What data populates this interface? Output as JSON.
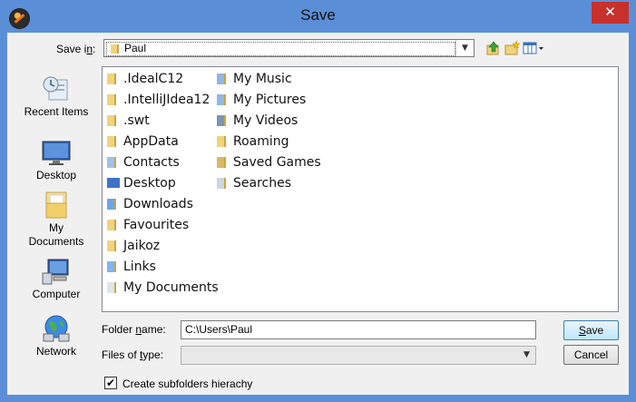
{
  "window": {
    "title": "Save",
    "close_glyph": "✕"
  },
  "toolbar": {
    "save_in_label": "Save in:",
    "save_in_value": "Paul",
    "up_icon": "up-one-level-icon",
    "new_folder_icon": "new-folder-icon",
    "view_menu_icon": "view-menu-icon"
  },
  "places": [
    {
      "label": "Recent Items",
      "icon": "recent-items-icon"
    },
    {
      "label": "Desktop",
      "icon": "desktop-icon"
    },
    {
      "label": "My Documents",
      "icon": "my-documents-icon"
    },
    {
      "label": "Computer",
      "icon": "computer-icon"
    },
    {
      "label": "Network",
      "icon": "network-icon"
    }
  ],
  "files": {
    "column1": [
      {
        "name": ".IdealC12",
        "icon": "folder-icon"
      },
      {
        "name": ".IntelliJIdea12",
        "icon": "folder-icon"
      },
      {
        "name": ".swt",
        "icon": "folder-icon"
      },
      {
        "name": "AppData",
        "icon": "folder-icon"
      },
      {
        "name": "Contacts",
        "icon": "contacts-folder-icon"
      },
      {
        "name": "Desktop",
        "icon": "desktop-folder-icon"
      },
      {
        "name": "Downloads",
        "icon": "downloads-folder-icon"
      },
      {
        "name": "Favourites",
        "icon": "favourites-folder-icon"
      },
      {
        "name": "Jaikoz",
        "icon": "folder-icon"
      },
      {
        "name": "Links",
        "icon": "links-folder-icon"
      },
      {
        "name": "My Documents",
        "icon": "my-documents-folder-icon"
      }
    ],
    "column2": [
      {
        "name": "My Music",
        "icon": "music-folder-icon"
      },
      {
        "name": "My Pictures",
        "icon": "pictures-folder-icon"
      },
      {
        "name": "My Videos",
        "icon": "videos-folder-icon"
      },
      {
        "name": "Roaming",
        "icon": "folder-icon"
      },
      {
        "name": "Saved Games",
        "icon": "saved-games-folder-icon"
      },
      {
        "name": "Searches",
        "icon": "searches-folder-icon"
      }
    ]
  },
  "form": {
    "folder_name_label": "Folder name:",
    "folder_name_value": "C:\\Users\\Paul",
    "files_of_type_label": "Files of type:",
    "files_of_type_value": ""
  },
  "buttons": {
    "save": "Save",
    "cancel": "Cancel"
  },
  "options": {
    "create_subfolders_label": "Create subfolders hierachy",
    "create_subfolders_checked": true
  }
}
